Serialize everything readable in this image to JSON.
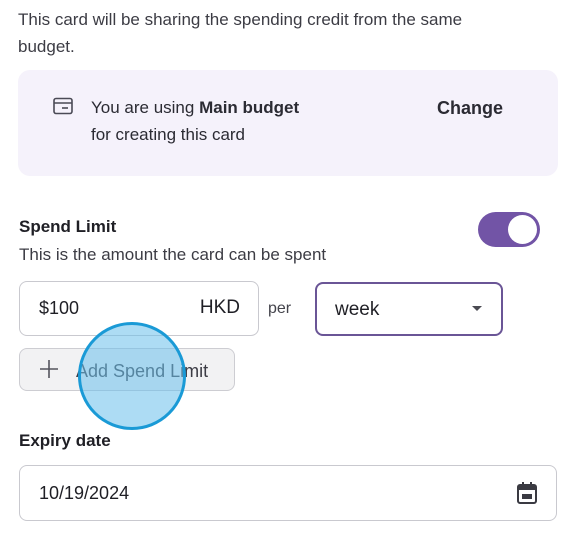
{
  "intro": {
    "line1": "This card will be sharing the spending credit from the same",
    "line2": "budget."
  },
  "budget_notice": {
    "prefix": "You are using ",
    "budget_name": "Main budget",
    "line2": "for creating this card",
    "change_label": "Change",
    "icon": "wallet-icon"
  },
  "spend_limit": {
    "title": "Spend Limit",
    "description": "This is the amount the card can be spent",
    "enabled": true,
    "amount": "$100",
    "currency": "HKD",
    "per_label": "per",
    "period": "week",
    "add_label": "Add Spend Limit"
  },
  "expiry": {
    "title": "Expiry date",
    "value": "10/19/2024",
    "icon": "calendar-icon"
  },
  "colors": {
    "accent": "#7254a6",
    "notice_bg": "#f5f2fb",
    "click_marker": "#1a9ad6"
  }
}
